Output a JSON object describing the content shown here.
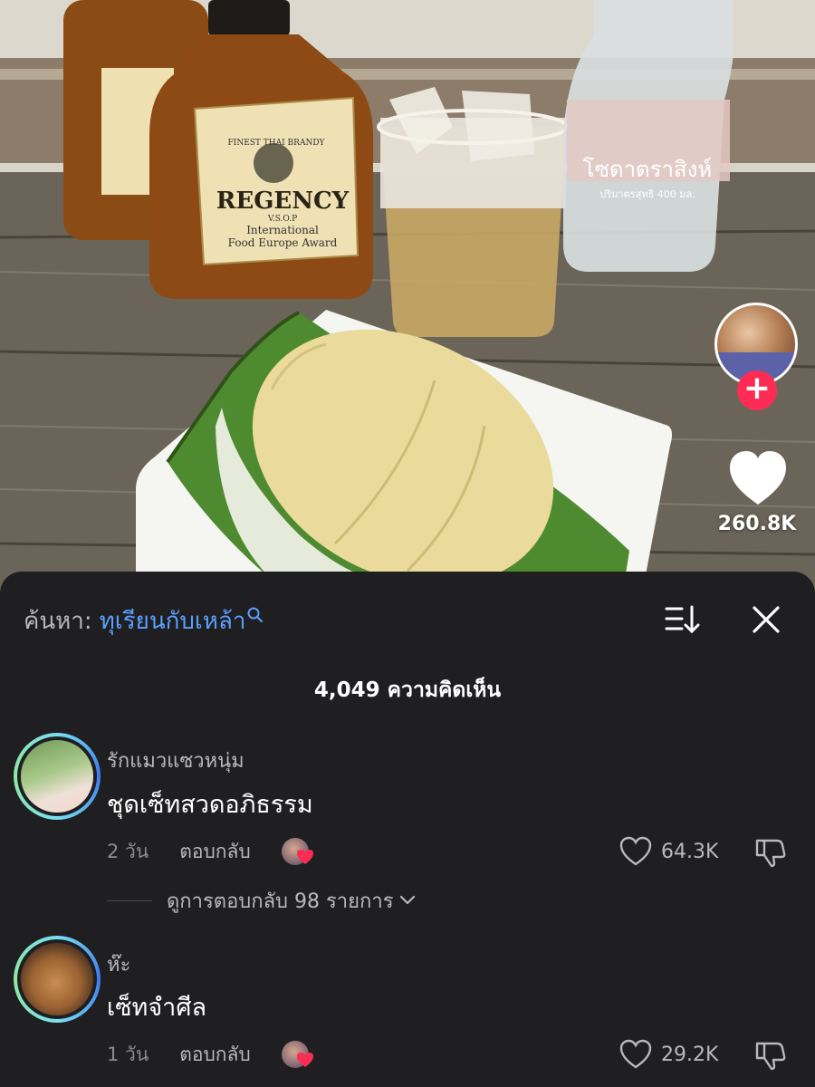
{
  "video": {
    "brandy_label_line1": "FINEST THAI BRANDY",
    "brandy_label_brand": "REGENCY",
    "brandy_label_grade": "V.S.O.P",
    "brandy_label_line2": "International",
    "brandy_label_line3": "Food Europe Award",
    "soda_label_text": "โซดาตราสิงห์",
    "soda_label_sub": "ปริมาตรสุทธิ 400 มล."
  },
  "side_rail": {
    "like_count": "260.8K",
    "follow_symbol": "+"
  },
  "sheet": {
    "search_prefix": "ค้นหา:",
    "search_term": "ทุเรียนกับเหล้า",
    "comment_count": "4,049 ความคิดเห็น"
  },
  "comments": [
    {
      "username": "รักแมวแซวหนุ่ม",
      "text": "ชุดเซ็ทสวดอภิธรรม",
      "time": "2 วัน",
      "reply_label": "ตอบกลับ",
      "likes": "64.3K"
    },
    {
      "username": "ห๊ะ",
      "text": "เซ็ทจำศีล",
      "time": "1 วัน",
      "reply_label": "ตอบกลับ",
      "likes": "29.2K"
    }
  ],
  "view_replies": "ดูการตอบกลับ 98 รายการ",
  "colors": {
    "sheet_bg": "#1f1f21",
    "accent_link": "#5aa0ff",
    "follow_red": "#fe2c55"
  }
}
